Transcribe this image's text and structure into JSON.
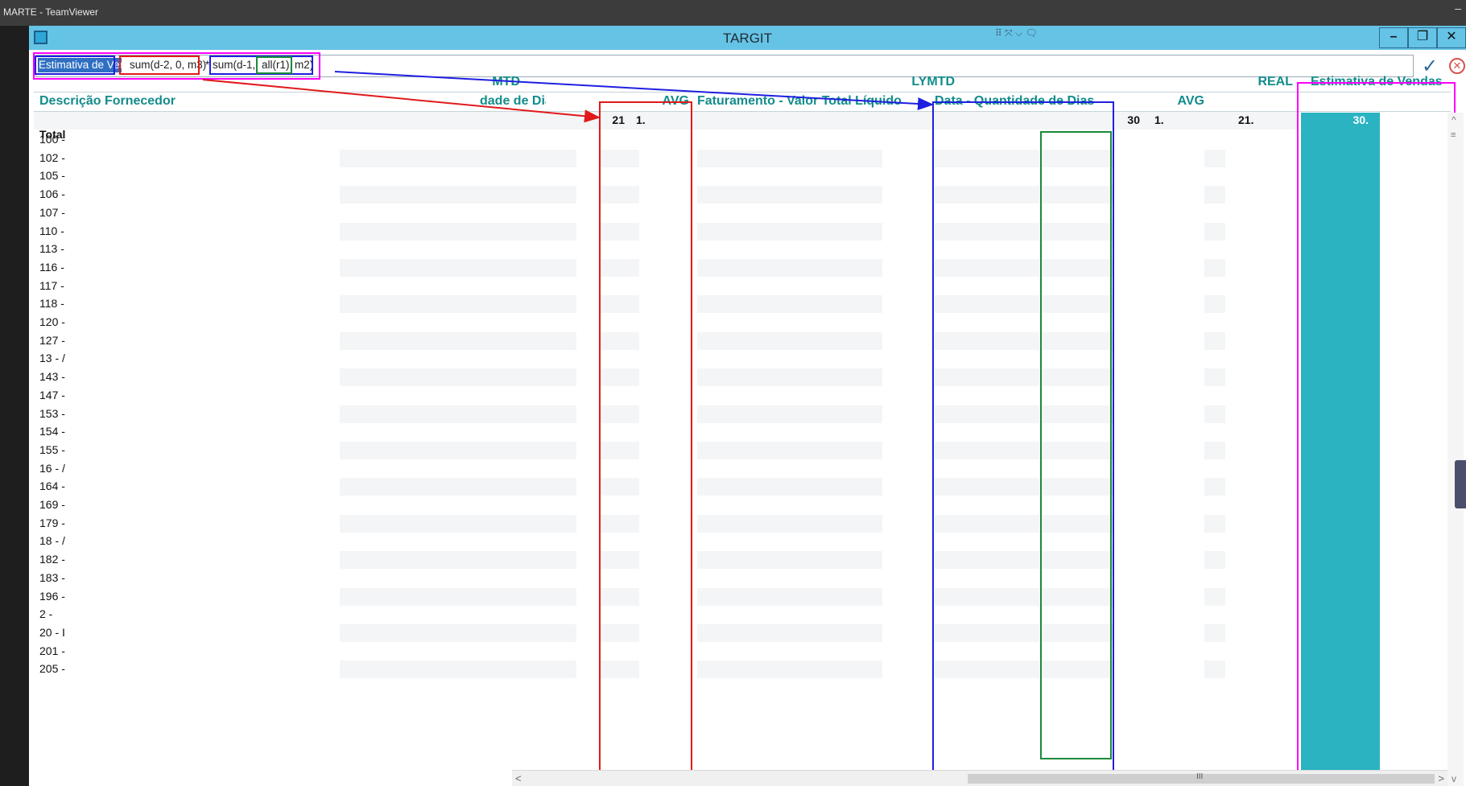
{
  "teamviewer": {
    "title": "MARTE - TeamViewer",
    "minimize": "–"
  },
  "app": {
    "title": "TARGIT",
    "toolbar_glyphs": "⠿ ⤧ ⌵ 🗨",
    "window_buttons": {
      "minimize": "–",
      "restore": "❐",
      "close": "✕"
    }
  },
  "formula": {
    "target": "Estimativa de Ver",
    "part1": "sum(d-2, 0, m3)",
    "operator": "*",
    "part2a": "sum(d-1,",
    "part2b": "all(r1),",
    "part2c": "m2)",
    "confirm": "✓",
    "cancel": "✕"
  },
  "headers": {
    "group_mtd": "MTD",
    "group_lymtd": "LYMTD",
    "group_real": "REAL",
    "estimativa": "Estimativa de Vendas",
    "descricao": "Descrição Fornecedor",
    "qtd_dias_trunc": "dade de Dias",
    "avg1": "AVG",
    "faturamento": "Faturamento - Valor Total Líquido",
    "data_qtd_dias": "Data - Quantidade de Dias",
    "avg2": "AVG"
  },
  "totals": {
    "label": "Total",
    "mtd_dias": "21",
    "avg1": "1.",
    "lymtd_dias": "30",
    "avg2": "1.",
    "real_dias": "21.",
    "estimativa": "30."
  },
  "rows": [
    "100 -",
    "102 -",
    "105 -",
    "106 -",
    "107 -",
    "110 -",
    "113 -",
    "116 -",
    "117 -",
    "118 -",
    "120 -",
    "127 -",
    "13 - /",
    "143 -",
    "147 -",
    "153 -",
    "154 -",
    "155 -",
    "16 - /",
    "164 -",
    "169 -",
    "179 -",
    "18 - /",
    "182 -",
    "183 -",
    "196 -",
    "2 -",
    "20 - I",
    "201 -",
    "205 -"
  ],
  "annotation_colors": {
    "red": "#e1191b",
    "blue": "#1f1fe0",
    "green": "#1b8a3a",
    "magenta": "#ff00ff"
  },
  "scroll": {
    "left_arrow": "<",
    "right_arrow": ">",
    "thumb_grip": "III",
    "up_arrow": "^",
    "down_arrow": "v",
    "grip": "≡"
  }
}
